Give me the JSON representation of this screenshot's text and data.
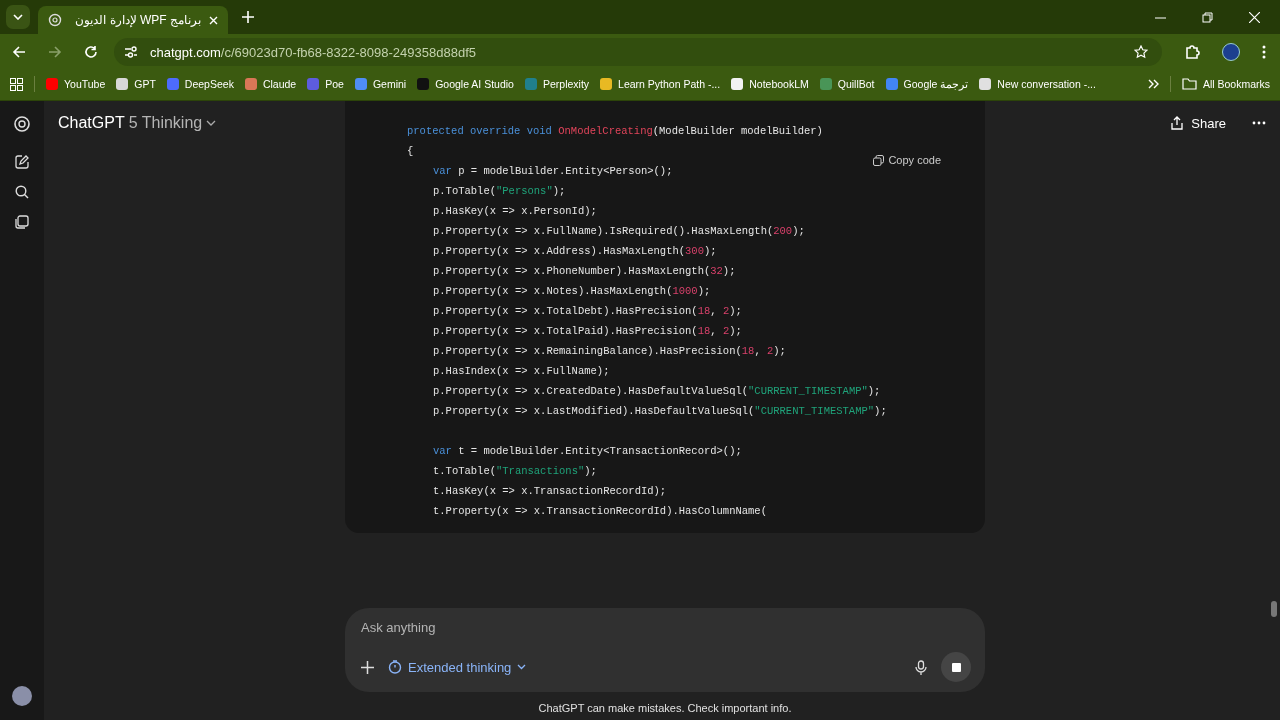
{
  "browser": {
    "tabs": [
      {
        "title": "برنامج WPF لإدارة الديون",
        "selected": true
      }
    ],
    "url": {
      "host": "chatgpt.com",
      "path": "/c/69023d70-fb68-8322-8098-249358d88df5"
    },
    "bookmarks": [
      {
        "label": "YouTube",
        "color": "#ff0000"
      },
      {
        "label": "GPT",
        "color": "#d8d8d8"
      },
      {
        "label": "DeepSeek",
        "color": "#4d6bfe"
      },
      {
        "label": "Claude",
        "color": "#d97757"
      },
      {
        "label": "Poe",
        "color": "#5d5cde"
      },
      {
        "label": "Gemini",
        "color": "#4f8df5"
      },
      {
        "label": "Google AI Studio",
        "color": "#111111"
      },
      {
        "label": "Perplexity",
        "color": "#20808d"
      },
      {
        "label": "Learn Python Path -...",
        "color": "#e8b923"
      },
      {
        "label": "NotebookLM",
        "color": "#f2f2f2"
      },
      {
        "label": "QuillBot",
        "color": "#499557"
      },
      {
        "label": "Google ترجمة",
        "color": "#4285f4"
      },
      {
        "label": "New conversation -...",
        "color": "#e0e0e0"
      }
    ],
    "all_bookmarks": "All Bookmarks"
  },
  "header": {
    "app": "ChatGPT",
    "model": "5 Thinking",
    "share": "Share"
  },
  "code_block": {
    "copy": "Copy code",
    "lines": [
      {
        "kind": "code",
        "tokens": [
          {
            "kind": "keyword",
            "text": "protected override void"
          },
          {
            "kind": "function",
            "text": " OnModelCreating"
          },
          {
            "kind": "plain",
            "text": "(ModelBuilder modelBuilder)"
          }
        ]
      },
      {
        "kind": "code",
        "tokens": [
          {
            "kind": "plain",
            "text": "{"
          }
        ],
        "children": [
          {
            "kind": "code",
            "tokens": [
              {
                "kind": "keyword",
                "text": "var"
              },
              {
                "kind": "plain",
                "text": " p = modelBuilder.Entity<Person>();"
              }
            ]
          },
          {
            "kind": "code",
            "tokens": [
              {
                "kind": "plain",
                "text": "p.ToTable("
              },
              {
                "kind": "string",
                "text": "\"Persons\""
              },
              {
                "kind": "plain",
                "text": ");"
              }
            ]
          },
          {
            "kind": "code",
            "tokens": [
              {
                "kind": "plain",
                "text": "p.HasKey(x => x.PersonId);"
              }
            ]
          },
          {
            "kind": "code",
            "tokens": [
              {
                "kind": "plain",
                "text": "p.Property(x => x.FullName).IsRequired().HasMaxLength("
              },
              {
                "kind": "number",
                "text": "200"
              },
              {
                "kind": "plain",
                "text": ");"
              }
            ]
          },
          {
            "kind": "code",
            "tokens": [
              {
                "kind": "plain",
                "text": "p.Property(x => x.Address).HasMaxLength("
              },
              {
                "kind": "number",
                "text": "300"
              },
              {
                "kind": "plain",
                "text": ");"
              }
            ]
          },
          {
            "kind": "code",
            "tokens": [
              {
                "kind": "plain",
                "text": "p.Property(x => x.PhoneNumber).HasMaxLength("
              },
              {
                "kind": "number",
                "text": "32"
              },
              {
                "kind": "plain",
                "text": ");"
              }
            ]
          },
          {
            "kind": "code",
            "tokens": [
              {
                "kind": "plain",
                "text": "p.Property(x => x.Notes).HasMaxLength("
              },
              {
                "kind": "number",
                "text": "1000"
              },
              {
                "kind": "plain",
                "text": ");"
              }
            ]
          },
          {
            "kind": "code",
            "tokens": [
              {
                "kind": "plain",
                "text": "p.Property(x => x.TotalDebt).HasPrecision("
              },
              {
                "kind": "number",
                "text": "18"
              },
              {
                "kind": "plain",
                "text": ", "
              },
              {
                "kind": "number",
                "text": "2"
              },
              {
                "kind": "plain",
                "text": ");"
              }
            ]
          },
          {
            "kind": "code",
            "tokens": [
              {
                "kind": "plain",
                "text": "p.Property(x => x.TotalPaid).HasPrecision("
              },
              {
                "kind": "number",
                "text": "18"
              },
              {
                "kind": "plain",
                "text": ", "
              },
              {
                "kind": "number",
                "text": "2"
              },
              {
                "kind": "plain",
                "text": ");"
              }
            ]
          },
          {
            "kind": "code",
            "tokens": [
              {
                "kind": "plain",
                "text": "p.Property(x => x.RemainingBalance).HasPrecision("
              },
              {
                "kind": "number",
                "text": "18"
              },
              {
                "kind": "plain",
                "text": ", "
              },
              {
                "kind": "number",
                "text": "2"
              },
              {
                "kind": "plain",
                "text": ");"
              }
            ]
          },
          {
            "kind": "code",
            "tokens": [
              {
                "kind": "plain",
                "text": "p.HasIndex(x => x.FullName);"
              }
            ]
          },
          {
            "kind": "code",
            "tokens": [
              {
                "kind": "plain",
                "text": "p.Property(x => x.CreatedDate).HasDefaultValueSql("
              },
              {
                "kind": "string",
                "text": "\"CURRENT_TIMESTAMP\""
              },
              {
                "kind": "plain",
                "text": ");"
              }
            ]
          },
          {
            "kind": "code",
            "tokens": [
              {
                "kind": "plain",
                "text": "p.Property(x => x.LastModified).HasDefaultValueSql("
              },
              {
                "kind": "string",
                "text": "\"CURRENT_TIMESTAMP\""
              },
              {
                "kind": "plain",
                "text": ");"
              }
            ]
          },
          {
            "kind": "blank"
          },
          {
            "kind": "code",
            "tokens": [
              {
                "kind": "keyword",
                "text": "var"
              },
              {
                "kind": "plain",
                "text": " t = modelBuilder.Entity<TransactionRecord>();"
              }
            ]
          },
          {
            "kind": "code",
            "tokens": [
              {
                "kind": "plain",
                "text": "t.ToTable("
              },
              {
                "kind": "string",
                "text": "\"Transactions\""
              },
              {
                "kind": "plain",
                "text": ");"
              }
            ]
          },
          {
            "kind": "code",
            "tokens": [
              {
                "kind": "plain",
                "text": "t.HasKey(x => x.TransactionRecordId);"
              }
            ]
          },
          {
            "kind": "code",
            "tokens": [
              {
                "kind": "plain",
                "text": "t.Property(x => x.TransactionRecordId).HasColumnName("
              }
            ]
          }
        ]
      }
    ]
  },
  "composer": {
    "placeholder": "Ask anything",
    "mode": "Extended thinking"
  },
  "footer": "ChatGPT can make mistakes. Check important info."
}
